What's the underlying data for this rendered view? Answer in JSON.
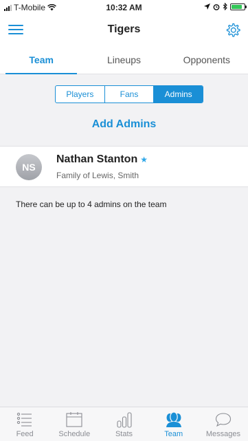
{
  "status_bar": {
    "carrier": "T-Mobile",
    "time": "10:32 AM"
  },
  "nav": {
    "title": "Tigers",
    "menu_icon": "hamburger-icon",
    "settings_icon": "gear-icon"
  },
  "tabs": [
    {
      "label": "Team",
      "active": true
    },
    {
      "label": "Lineups",
      "active": false
    },
    {
      "label": "Opponents",
      "active": false
    }
  ],
  "segments": [
    {
      "label": "Players",
      "active": false
    },
    {
      "label": "Fans",
      "active": false
    },
    {
      "label": "Admins",
      "active": true
    }
  ],
  "add_admins_label": "Add Admins",
  "admins": [
    {
      "initials": "NS",
      "name": "Nathan Stanton",
      "subtitle": "Family of Lewis, Smith"
    }
  ],
  "info_text": "There can be up to 4 admins on the team",
  "bottom_tabs": [
    {
      "label": "Feed",
      "icon": "feed-icon",
      "active": false
    },
    {
      "label": "Schedule",
      "icon": "calendar-icon",
      "active": false
    },
    {
      "label": "Stats",
      "icon": "stats-icon",
      "active": false
    },
    {
      "label": "Team",
      "icon": "team-icon",
      "active": true
    },
    {
      "label": "Messages",
      "icon": "messages-icon",
      "active": false
    }
  ],
  "colors": {
    "accent": "#1a8fd6",
    "battery": "#34c759",
    "star": "#2fa7e8"
  }
}
